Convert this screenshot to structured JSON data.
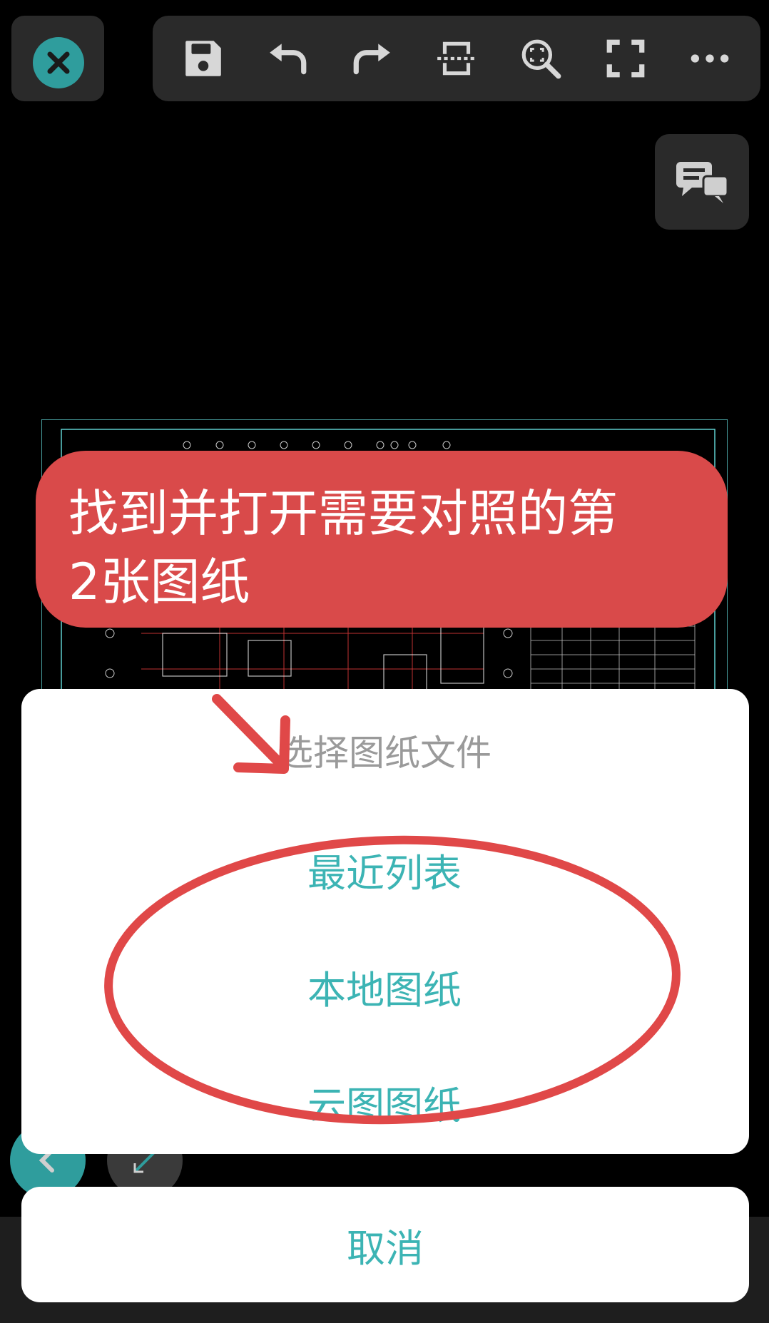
{
  "toolbar": {
    "close_icon": "close-icon",
    "tools": [
      "save-icon",
      "undo-icon",
      "redo-icon",
      "split-view-icon",
      "zoom-fit-icon",
      "fullscreen-icon",
      "more-icon"
    ],
    "chat_icon": "comment-icon"
  },
  "callout": {
    "line1": "找到并打开需要对照的第",
    "line2": "2张图纸"
  },
  "sheet": {
    "title": "选择图纸文件",
    "options": [
      "最近列表",
      "本地图纸",
      "云图图纸"
    ],
    "cancel": "取消"
  },
  "colors": {
    "accent": "#3cb4b4",
    "teal_button": "#2f9d9d",
    "annotation_red": "#d94a4a"
  }
}
